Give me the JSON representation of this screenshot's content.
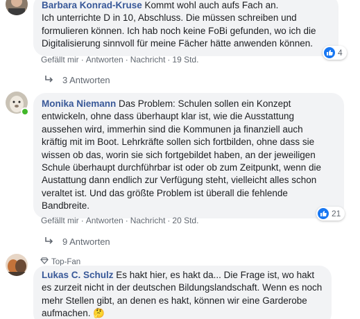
{
  "comments": [
    {
      "author": "Barbara Konrad-Kruse",
      "lines": [
        " Kommt wohl auch aufs Fach an.",
        "Ich unterrichte D in 10, Abschluss. Die müssen schreiben und",
        "formulieren können. Ich hab noch keine FoBi gefunden, wo ich die",
        "Digitalisierung sinnvoll für meine Fächer hätte anwenden können."
      ],
      "reactions": "4",
      "actions": {
        "like": "Gefällt mir",
        "reply": "Antworten",
        "message": "Nachricht",
        "time": "19 Std."
      },
      "replies_label": "3 Antworten"
    },
    {
      "author": "Monika Niemann",
      "lines": [
        " Das Problem: Schulen sollen ein Konzept",
        "entwickeln, ohne dass überhaupt klar ist, wie die Ausstattung",
        "aussehen wird, immerhin sind die Kommunen ja finanziell auch",
        "kräftig mit im Boot. Lehrkräfte sollen sich fortbilden, ohne dass sie",
        "wissen ob das, worin sie sich fortgebildet haben, an der jeweiligen",
        "Schule überhaupt durchführbar ist oder ob zum Zeitpunkt, wenn die",
        "Austattung dann endlich zur Verfügung steht, vielleicht alles schon",
        "veraltet ist. Und das größte Problem ist überall die fehlende",
        "Bandbreite."
      ],
      "reactions": "21",
      "actions": {
        "like": "Gefällt mir",
        "reply": "Antworten",
        "message": "Nachricht",
        "time": "20 Std."
      },
      "replies_label": "9 Antworten"
    },
    {
      "badge": "Top-Fan",
      "author": "Lukas C. Schulz",
      "lines": [
        " Es hakt hier, es hakt da... Die Frage ist, wo hakt",
        "es zurzeit nicht in der deutschen Bildungslandschaft. Wenn es noch",
        "mehr Stellen gibt, an denen es hakt, können wir eine Garderobe",
        "aufmachen. 🤔"
      ]
    }
  ],
  "colors": {
    "author": "#385898",
    "bubble": "#f2f3f5",
    "like": "#1877f2",
    "meta": "#606770"
  }
}
